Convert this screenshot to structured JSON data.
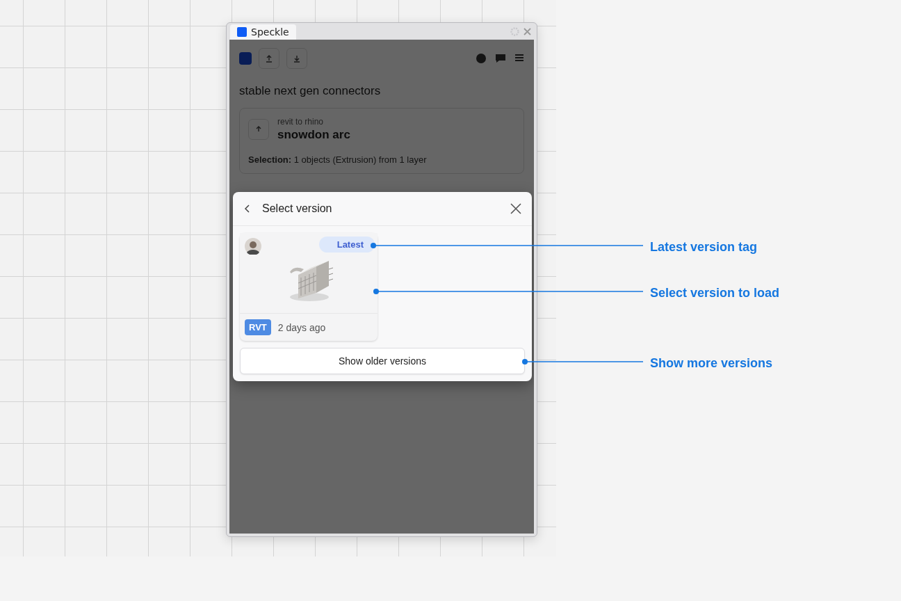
{
  "window": {
    "tab_title": "Speckle"
  },
  "background": {
    "project": "stable next gen connectors",
    "model_subtitle": "revit to rhino",
    "model_name": "snowdon arc",
    "selection": "**Selection:** 1 objects (Extrusion) from 1 layer"
  },
  "dialog": {
    "title": "Select version",
    "versions": [
      {
        "latest_tag": "Latest",
        "source": "RVT",
        "time": "2 days ago",
        "kind": "picture"
      }
    ],
    "older_button": "Show older versions"
  },
  "annotations": [
    {
      "label": "Latest version tag"
    },
    {
      "label": "Select version to load"
    },
    {
      "label": "Show more versions"
    }
  ]
}
